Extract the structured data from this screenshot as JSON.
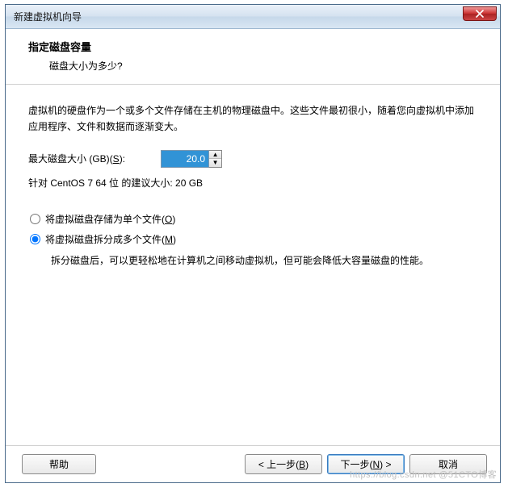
{
  "window": {
    "title": "新建虚拟机向导"
  },
  "header": {
    "title": "指定磁盘容量",
    "subtitle": "磁盘大小为多少?"
  },
  "content": {
    "description": "虚拟机的硬盘作为一个或多个文件存储在主机的物理磁盘中。这些文件最初很小，随着您向虚拟机中添加应用程序、文件和数据而逐渐变大。",
    "size_label_prefix": "最大磁盘大小 (GB)(",
    "size_label_key": "S",
    "size_label_suffix": "):",
    "size_value": "20.0",
    "recommend": "针对 CentOS 7 64 位 的建议大小: 20 GB",
    "radio_single_prefix": "将虚拟磁盘存储为单个文件(",
    "radio_single_key": "O",
    "radio_single_suffix": ")",
    "radio_split_prefix": "将虚拟磁盘拆分成多个文件(",
    "radio_split_key": "M",
    "radio_split_suffix": ")",
    "radio_split_note": "拆分磁盘后，可以更轻松地在计算机之间移动虚拟机，但可能会降低大容量磁盘的性能。",
    "selected_option": "split"
  },
  "footer": {
    "help": "帮助",
    "back_prefix": "< 上一步(",
    "back_key": "B",
    "back_suffix": ")",
    "next_prefix": "下一步(",
    "next_key": "N",
    "next_suffix": ") >",
    "cancel": "取消"
  },
  "watermark": "https://blog.csdn.net @51CTO博客"
}
